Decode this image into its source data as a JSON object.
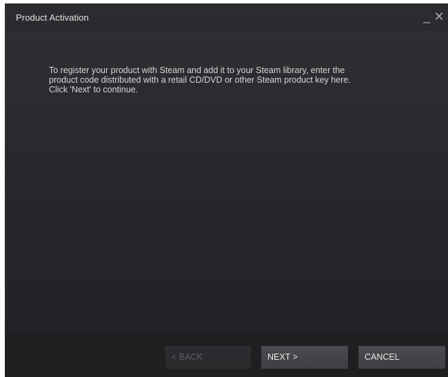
{
  "window": {
    "title": "Product Activation",
    "minimize_glyph": "_",
    "close_glyph": "✕"
  },
  "content": {
    "instructions": "To register your product with Steam and add it to your Steam library, enter the product code distributed with a retail CD/DVD or other Steam product key here. Click 'Next' to continue."
  },
  "footer": {
    "back_label": "< BACK",
    "next_label": "NEXT >",
    "cancel_label": "CANCEL"
  },
  "colors": {
    "background": "#232427",
    "text": "#d6d6d6",
    "button": "#434447",
    "disabled_text": "#5e5f62"
  }
}
